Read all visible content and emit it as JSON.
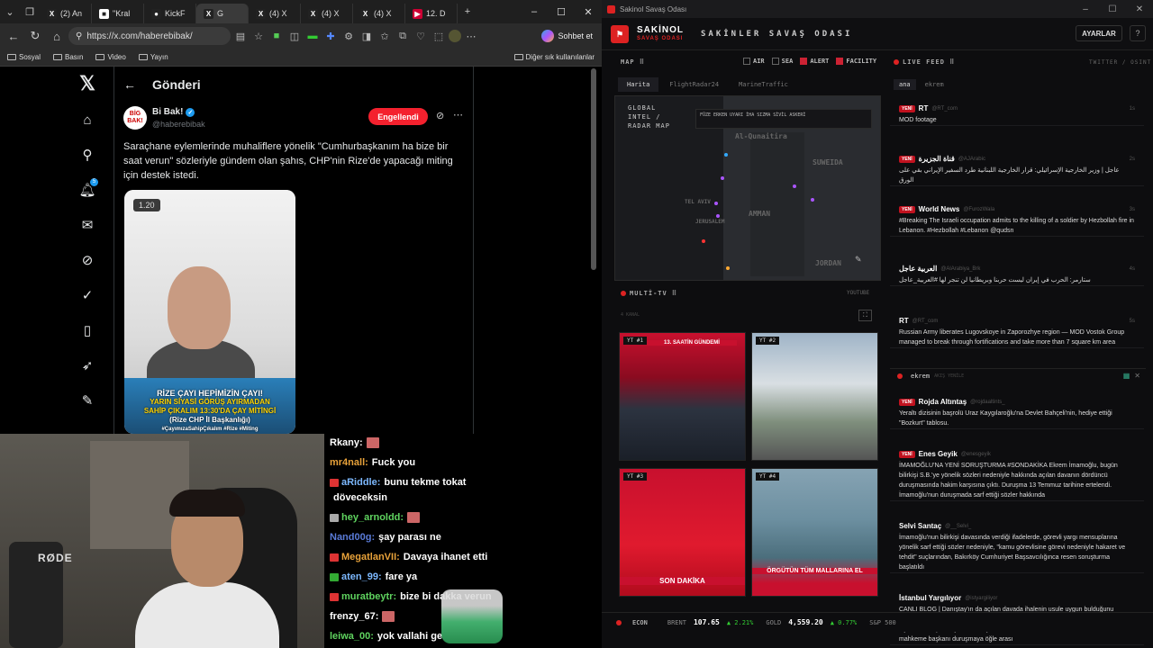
{
  "browser": {
    "tabs": [
      {
        "icon": "X",
        "label": "(2) An",
        "active": false
      },
      {
        "icon": "■",
        "label": "\"Kral",
        "active": false
      },
      {
        "icon": "●",
        "label": "KickF",
        "active": false
      },
      {
        "icon": "X",
        "label": "G",
        "active": true
      },
      {
        "icon": "X",
        "label": "(4) X",
        "active": false
      },
      {
        "icon": "X",
        "label": "(4) X",
        "active": false
      },
      {
        "icon": "X",
        "label": "(4) X",
        "active": false
      },
      {
        "icon": "▶",
        "label": "12. D",
        "active": false
      }
    ],
    "url": "https://x.com/haberebibak/",
    "copilot_label": "Sohbet et",
    "favorites": [
      "Sosyal",
      "Basın",
      "Video",
      "Yayın"
    ],
    "other_favorites": "Diğer sık kullanılanlar"
  },
  "x": {
    "header_title": "Gönderi",
    "author_name": "Bi Bak!",
    "author_handle": "@haberebibak",
    "avatar_text": "BİG BAK!",
    "block_label": "Engellendi",
    "tweet_text": "Saraçhane eylemlerinde muhaliflere yönelik \"Cumhurbaşkanım ha bize bir saat verun\" sözleriyle gündem olan şahıs, CHP'nin Rize'de yapacağı miting için destek istedi.",
    "video_duration": "1.20",
    "video_caption_1": "RİZE ÇAYI HEPİMİZİN ÇAYI!",
    "video_caption_2": "YARIN SİYASİ GÖRÜŞ AYIRMADAN",
    "video_caption_3": "SAHİP ÇIKALIM 13:30'DA ÇAY MİTİNGİ",
    "video_caption_4": "(Rize CHP İl Başkanlığı)",
    "video_caption_5": "#ÇayımızaSahipÇıkalım #Rize #Miting",
    "nav_badge": "5"
  },
  "webcam": {
    "mic_brand": "RØDE"
  },
  "chat": [
    {
      "user": "Rkany:",
      "text": "",
      "color": "#ffffff",
      "badge": ""
    },
    {
      "user": "mr4nall:",
      "text": "Fuck you",
      "color": "#e8a23a",
      "badge": ""
    },
    {
      "user": "aRiddle:",
      "text": "bunu tekme tokat",
      "color": "#7db9ff",
      "badge": "#d33"
    },
    {
      "user": "",
      "text": "döveceksin",
      "color": "#ffffff",
      "badge": ""
    },
    {
      "user": "hey_arnoldd:",
      "text": "",
      "color": "#5fd35f",
      "badge": "#aaa"
    },
    {
      "user": "Nand00g:",
      "text": "şay parası ne",
      "color": "#5a7bd8",
      "badge": ""
    },
    {
      "user": "MegatlanVII:",
      "text": "Davaya ihanet etti",
      "color": "#e8a23a",
      "badge": "#d33"
    },
    {
      "user": "aten_99:",
      "text": "fare ya",
      "color": "#7db9ff",
      "badge": "#3a3"
    },
    {
      "user": "muratbeytr:",
      "text": "bize bi dakka verun",
      "color": "#5fd35f",
      "badge": "#d33"
    },
    {
      "user": "frenzy_67:",
      "text": "",
      "color": "#ffffff",
      "badge": ""
    },
    {
      "user": "leiwa_00:",
      "text": "yok vallahi ge",
      "color": "#5fd35f",
      "badge": ""
    }
  ],
  "app": {
    "window_title": "Sakinol Savaş Odası",
    "logo_main": "SAKİNOL",
    "logo_sub": "SAVAŞ ODASI",
    "title": "SAKİNLER SAVAŞ ODASI",
    "settings_label": "AYARLAR",
    "help_label": "?",
    "map_section": "MAP",
    "map_filters": [
      {
        "label": "AIR",
        "checked": false
      },
      {
        "label": "SEA",
        "checked": false
      },
      {
        "label": "ALERT",
        "checked": true
      },
      {
        "label": "FACILITY",
        "checked": true
      }
    ],
    "map_tabs": [
      "Harita",
      "FlightRadar24",
      "MarineTraffic"
    ],
    "map_title_1": "GLOBAL",
    "map_title_2": "INTEL /",
    "map_title_3": "RADAR MAP",
    "map_legend": "FÜZE  ERKEN UYARI  İHA  SIZMA  SİVİL  ASKERİ",
    "map_labels": [
      "Al-Qunaitira",
      "SUWEIDA",
      "TEL AVIV",
      "AMMAN",
      "JERUSALEM",
      "JORDAN"
    ],
    "live_section": "LIVE FEED",
    "live_sources": "TWITTER / OSINT",
    "live_tabs": [
      "ana",
      "ekrem"
    ],
    "multitv_section": "MULTİ-TV",
    "multitv_source": "YOUTUBE",
    "multitv_sub": "4 KANAL",
    "tv": [
      {
        "tag": "YT #1",
        "text": "13. SAATİN GÜNDEMİ"
      },
      {
        "tag": "YT #2",
        "text": ""
      },
      {
        "tag": "YT #3",
        "text": "SON DAKİKA"
      },
      {
        "tag": "YT #4",
        "text": "ÖRGÜTÜN TÜM MALLARINA EL"
      }
    ],
    "feed2_label": "ekrem",
    "feed2_sub": "AKIŞ YENİLE",
    "feed1": [
      {
        "new": true,
        "src": "RT",
        "handle": "@RT_com",
        "time": "1s",
        "text": "MOD footage"
      },
      {
        "new": true,
        "src": "قناة الجزيرة",
        "handle": "@AJArabic",
        "time": "2s",
        "text": "عاجل | وزير الخارجية الإسرائيلي: قرار الخارجية اللبنانية طرد السفير الإيراني بقي على الورق"
      },
      {
        "new": true,
        "src": "World News",
        "handle": "@FurozWala",
        "time": "3s",
        "text": "#Breaking The Israeli occupation admits to the killing of a soldier by Hezbollah fire in Lebanon. #Hezbollah #Lebanon @qudsn"
      },
      {
        "new": false,
        "src": "العربية عاجل",
        "handle": "@AlArabiya_Brk",
        "time": "4s",
        "text": "ستارمر: الحرب في إيران ليست حربنا وبريطانيا لن تنجر لها #العربية_عاجل"
      },
      {
        "new": false,
        "src": "RT",
        "handle": "@RT_com",
        "time": "5s",
        "text": "Russian Army liberates Lugovskoye in Zaporozhye region — MOD Vostok Group managed to break through fortifications and take more than 7 square km area"
      }
    ],
    "feed2": [
      {
        "new": true,
        "src": "Rojda Altıntaş",
        "handle": "@rojdaaltints_",
        "time": "",
        "text": "Yeraltı dizisinin başrolü Uraz Kaygılaroğlu'na Devlet Bahçeli'nin, hediye ettiği \"Bozkurt\" tablosu."
      },
      {
        "new": true,
        "src": "Enes Geyik",
        "handle": "@enesgeyik",
        "time": "",
        "text": "İMAMOĞLU'NA YENİ SORUŞTURMA #SONDAKİKA Ekrem İmamoğlu, bugün bilirkişi S.B.'ye yönelik sözleri nedeniyle hakkında açılan davanın dördüncü duruşmasında hakim karşısına çıktı. Duruşma 13 Temmuz tarihine ertelendi. İmamoğlu'nun duruşmada sarf ettiği sözler hakkında"
      },
      {
        "new": false,
        "src": "Selvi Santaç",
        "handle": "@__Selvi_",
        "time": "",
        "text": "İmamoğlu'nun bilirkişi davasında verdiği ifadelerde, görevli yargı mensuplarına yönelik sarf ettiği sözler nedeniyle, \"kamu görevlisine görevi nedeniyle hakaret ve tehdit\" suçlarından, Bakırköy Cumhuriyet Başsavcılığınca resen soruşturma başlatıldı"
      },
      {
        "new": false,
        "src": "İstanbul Yargılıyor",
        "handle": "@istyargiliyor",
        "time": "",
        "text": "CANLI BLOG | Danıştay'ın da açılan davada ihalenin usule uygun bulduğunu belirten avukat Uzun, \"Tam bu noktada cumhuriyet savcısı çıkıyor, usulsüzlük vardır diyor ve soruşturmaya dahil ediyor\" ifadelerini kullandı. Uzun'un sözlerinin ardından mahkeme başkanı duruşmaya öğle arası"
      }
    ],
    "econ": {
      "label": "ECON",
      "items": [
        {
          "k": "BRENT",
          "v": "107.65",
          "c": "▲ 2.21%"
        },
        {
          "k": "GOLD",
          "v": "4,559.20",
          "c": "▲ 0.77%"
        },
        {
          "k": "S&P 500",
          "v": "",
          "c": ""
        }
      ]
    },
    "colors": {
      "accent": "#d22",
      "bg": "#0d0d0f"
    }
  }
}
